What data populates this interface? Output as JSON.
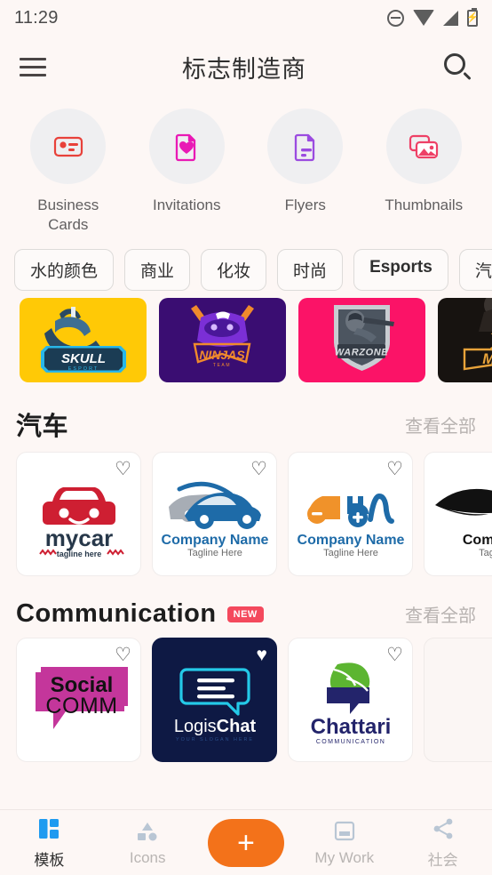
{
  "status_bar": {
    "time": "11:29",
    "icons": [
      "dnd-icon",
      "wifi-icon",
      "signal-icon",
      "battery-charging-icon"
    ],
    "battery_glyph": "⚡"
  },
  "app_bar": {
    "menu_icon": "hamburger-menu-icon",
    "title": "标志制造商",
    "search_icon": "search-icon"
  },
  "quick_categories": [
    {
      "label": "Business Cards",
      "icon": "business-card-icon",
      "color": "#E8413A"
    },
    {
      "label": "Invitations",
      "icon": "invitation-heart-icon",
      "color": "#E919B5"
    },
    {
      "label": "Flyers",
      "icon": "flyer-document-icon",
      "color": "#9B4BE0"
    },
    {
      "label": "Thumbnails",
      "icon": "thumbnails-images-icon",
      "color": "#EE4066"
    }
  ],
  "chips": [
    {
      "label": "水的颜色",
      "active": false
    },
    {
      "label": "商业",
      "active": false
    },
    {
      "label": "化妆",
      "active": false
    },
    {
      "label": "时尚",
      "active": false
    },
    {
      "label": "Esports",
      "active": true
    },
    {
      "label": "汽车",
      "active": false
    }
  ],
  "esports_strip": [
    {
      "name": "SKULL",
      "sub": "ESPORT",
      "bg": "#FFC906",
      "accent": "#28B6E8"
    },
    {
      "name": "NINJAS",
      "sub": "TEAM",
      "bg": "#3A0D72",
      "accent": "#F08A2C"
    },
    {
      "name": "WARZONE",
      "sub": "",
      "bg": "#FB1367",
      "accent": "#C9CDD2"
    },
    {
      "name": "MO",
      "sub": "",
      "bg": "#171310",
      "accent": "#E8A33A"
    }
  ],
  "sections": [
    {
      "title": "汽车",
      "badge": null,
      "see_all": "查看全部",
      "cards": [
        {
          "kind": "mycar",
          "name": "mycar",
          "tagline": "tagline here",
          "favorited": false,
          "color": "#CE1F32"
        },
        {
          "kind": "sportscar",
          "name": "Company Name",
          "tagline": "Tagline Here",
          "favorited": false,
          "color": "#1E6BA8"
        },
        {
          "kind": "evcar",
          "name": "Company Name",
          "tagline": "Tagline Here",
          "favorited": false,
          "color": "#1E6BA8"
        },
        {
          "kind": "blackcar",
          "name": "Compa",
          "tagline": "Tag",
          "favorited": false,
          "color": "#111111"
        }
      ]
    },
    {
      "title": "Communication",
      "badge": "NEW",
      "see_all": "查看全部",
      "cards": [
        {
          "kind": "socialcomm",
          "name": "Social",
          "name2": "COMM",
          "tagline": "",
          "favorited": false,
          "color": "#C4369B"
        },
        {
          "kind": "logischat",
          "name": "Logis",
          "name2": "Chat",
          "tagline": "YOUR SLOGAN HERE",
          "favorited": true,
          "color": "#24C9E8"
        },
        {
          "kind": "chattari",
          "name": "Chattari",
          "tagline": "COMMUNICATION",
          "favorited": false,
          "color": "#23246B"
        },
        {
          "kind": "empty",
          "name": "",
          "tagline": "",
          "favorited": false,
          "color": "#FBF6F4"
        }
      ]
    }
  ],
  "bottom_nav": {
    "items": [
      {
        "label": "模板",
        "icon": "templates-grid-icon",
        "active": true
      },
      {
        "label": "Icons",
        "icon": "shapes-icon",
        "active": false
      },
      {
        "label": "",
        "icon": "add-plus-icon",
        "active": false,
        "is_fab": true
      },
      {
        "label": "My Work",
        "icon": "inbox-icon",
        "active": false
      },
      {
        "label": "社会",
        "icon": "share-icon",
        "active": false
      }
    ],
    "fab_glyph": "+"
  },
  "colors": {
    "background": "#FDF7F5",
    "accent_orange": "#F3721A",
    "accent_blue": "#1E9BF0",
    "badge_red": "#F4495D"
  }
}
